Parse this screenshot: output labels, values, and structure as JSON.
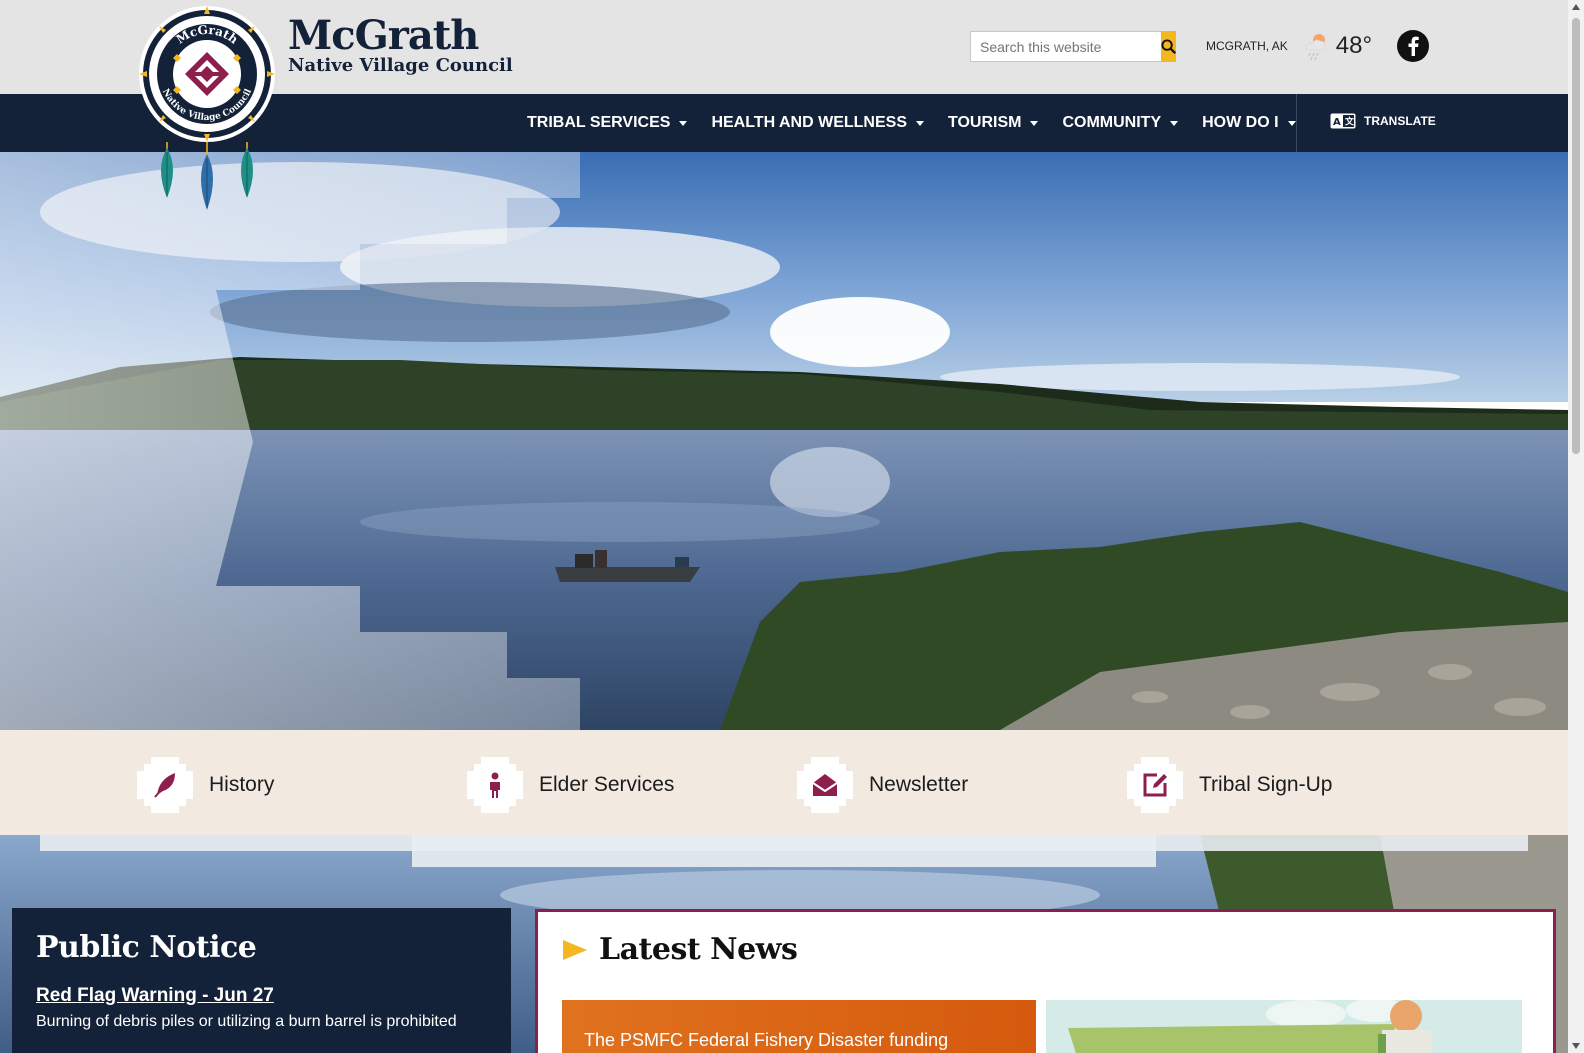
{
  "header": {
    "brand_line1": "McGrath",
    "brand_line2": "Native Village Council",
    "logo_text_top": "McGrath",
    "logo_text_bottom": "Native Village Council",
    "search_placeholder": "Search this website",
    "location": "MCGRATH, AK",
    "temperature": "48°",
    "weather_icon": "rain-cloud-icon",
    "social_icon": "facebook-icon"
  },
  "nav": {
    "items": [
      {
        "label": "TRIBAL SERVICES"
      },
      {
        "label": "HEALTH AND WELLNESS"
      },
      {
        "label": "TOURISM"
      },
      {
        "label": "COMMUNITY"
      },
      {
        "label": "HOW DO I"
      }
    ],
    "translate_label": "TRANSLATE"
  },
  "quick_links": [
    {
      "label": "History",
      "icon": "feather-icon"
    },
    {
      "label": "Elder Services",
      "icon": "person-icon"
    },
    {
      "label": "Newsletter",
      "icon": "envelope-open-icon"
    },
    {
      "label": "Tribal Sign-Up",
      "icon": "edit-icon"
    }
  ],
  "notice": {
    "heading": "Public Notice",
    "title": "Red Flag Warning - Jun 27",
    "body": "Burning of debris piles or utilizing a burn barrel is prohibited"
  },
  "news": {
    "heading": "Latest News",
    "card1_text": "The PSMFC Federal Fishery Disaster funding"
  },
  "colors": {
    "navy": "#132238",
    "gold": "#f4b71f",
    "maroon": "#8c1f4e",
    "teal": "#1d8f86",
    "cream": "#f2eae1"
  }
}
